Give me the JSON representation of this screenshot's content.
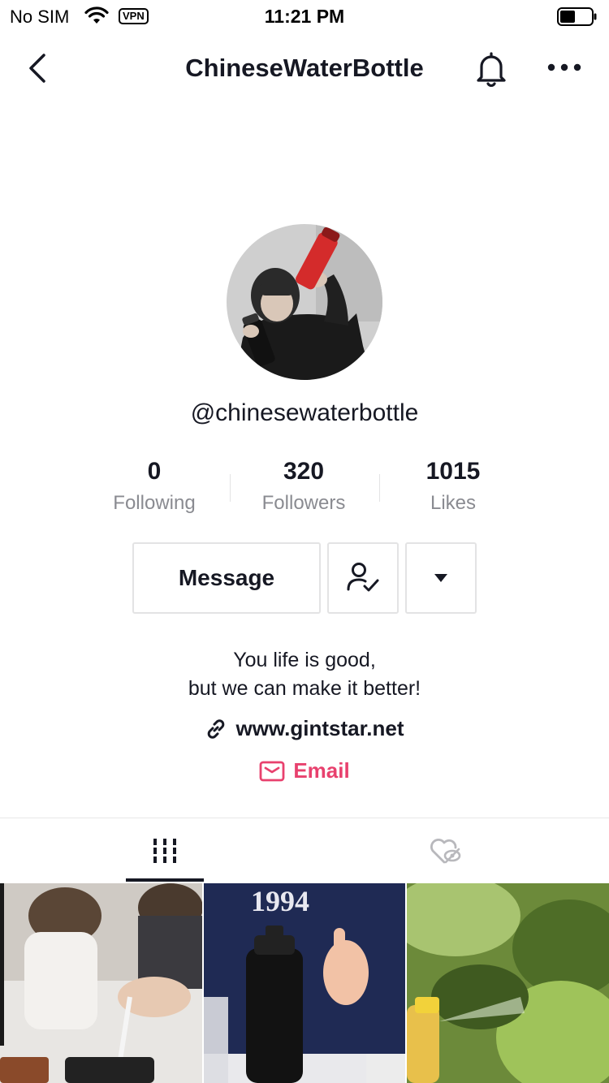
{
  "status_bar": {
    "carrier": "No SIM",
    "vpn": "VPN",
    "time": "11:21 PM"
  },
  "nav": {
    "title": "ChineseWaterBottle"
  },
  "profile": {
    "username": "@chinesewaterbottle",
    "stats": [
      {
        "value": "0",
        "label": "Following"
      },
      {
        "value": "320",
        "label": "Followers"
      },
      {
        "value": "1015",
        "label": "Likes"
      }
    ],
    "message_label": "Message",
    "bio_line1": "You life is good,",
    "bio_line2": "but we can make it better!",
    "website": "www.gintstar.net",
    "email_label": "Email"
  },
  "thumbnails": {
    "second_shirt_text": "1994"
  },
  "colors": {
    "text_primary": "#161823",
    "text_secondary": "#8a8b91",
    "accent_email": "#e8416e",
    "border": "#e3e3e4"
  },
  "icons": [
    "back-chevron-icon",
    "bell-icon",
    "more-dots-icon",
    "user-check-icon",
    "caret-down-icon",
    "link-icon",
    "mail-icon",
    "grid-icon",
    "liked-heart-hidden-icon"
  ]
}
